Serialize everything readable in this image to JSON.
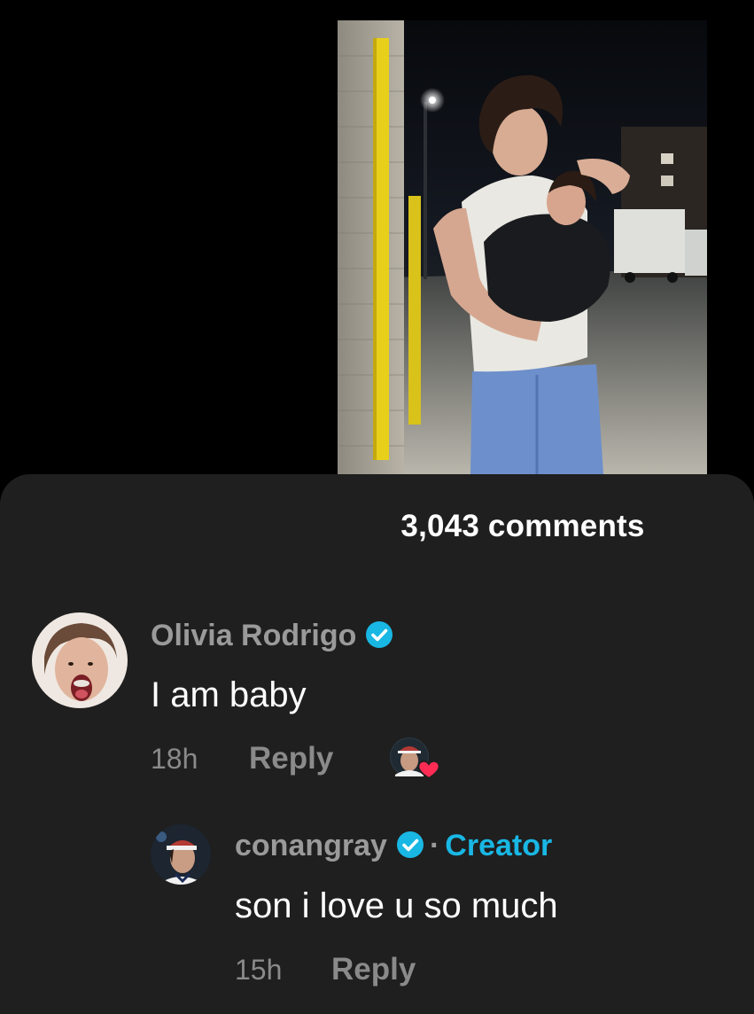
{
  "comments_sheet": {
    "count_label": "3,043 comments"
  },
  "comments": [
    {
      "username": "Olivia Rodrigo",
      "verified": true,
      "text": "I am baby",
      "time": "18h",
      "reply_label": "Reply",
      "liked_by_creator": true
    }
  ],
  "replies": [
    {
      "username": "conangray",
      "verified": true,
      "separator": "·",
      "badge": "Creator",
      "text": "son i love u so much",
      "time": "15h",
      "reply_label": "Reply"
    }
  ],
  "colors": {
    "sheet_bg": "#1f1f1f",
    "verified": "#19b7e4",
    "creator_badge": "#19b7e4",
    "like_heart": "#fe2c55"
  },
  "icons": [
    "verified-badge-icon",
    "creator-like-heart-icon"
  ]
}
